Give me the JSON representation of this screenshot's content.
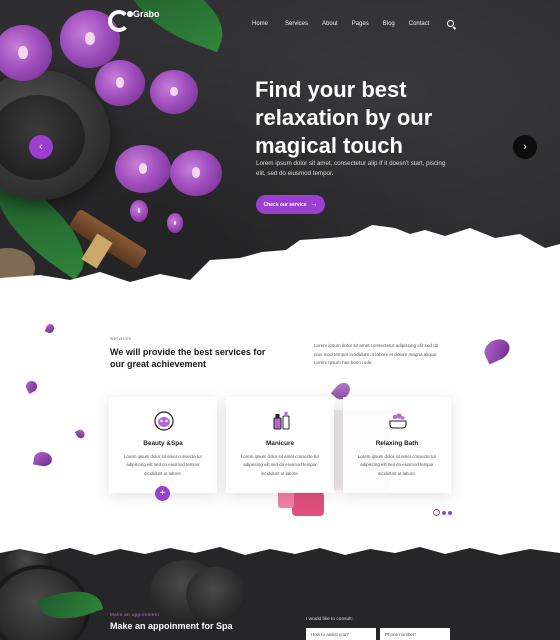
{
  "header": {
    "logo_text": "Grabo",
    "menu": [
      "Home",
      "Services",
      "About",
      "Pages",
      "Blog",
      "Contact"
    ]
  },
  "hero": {
    "title": "Find your best relaxation by our magical touch",
    "subtitle": "Lorem ipsum dolor sit amet, consectetur alip If it doesn't start, piscing elit, sed do eiusmod tempor.",
    "cta_label": "Check our service",
    "cta_arrow": "→",
    "prev_arrow": "‹",
    "next_arrow": "›"
  },
  "services": {
    "eyebrow": "Services",
    "heading": "We will provide the best services for our great achievement",
    "intro": "Lorem ipsum dolor sit amet consectetur adipiscing elit sed do eius mod tempor incididunt ut labore et dolore magna aliqua. Lorem Ipsum has been rode.",
    "cards": [
      {
        "title": "Beauty &Spa",
        "text": "Lorem ipsum dolor sit amet consecte tur adipiscing elit sed do eiusmod tempor incididunt ut labore."
      },
      {
        "title": "Manicure",
        "text": "Lorem ipsum dolor sit amet consecte tur adipiscing elit sed do eiusmod tempor incididunt ut labore."
      },
      {
        "title": "Relaxing Bath",
        "text": "Lorem ipsum dolor sit amet consecte tur adipiscing elit sed do eiusmod tempor incididunt ut labore."
      }
    ],
    "plus_label": "+"
  },
  "appointment": {
    "eyebrow": "Make an appoinment",
    "title": "Make an appoinment for Spa",
    "consult_label": "I would like to consult:",
    "fields": [
      "How to assist you?",
      "Phone number*"
    ]
  },
  "colors": {
    "accent": "#9b3fd0",
    "dark": "#2e2e30"
  }
}
